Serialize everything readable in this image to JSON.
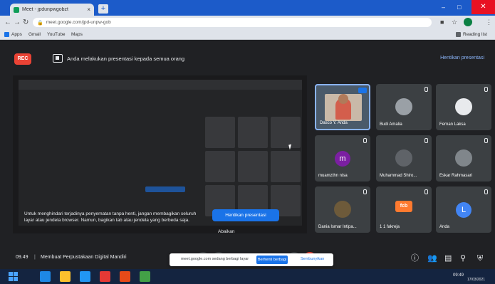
{
  "browser": {
    "tab_title": "Meet - jpdunpwgobzt",
    "tab_close": "×",
    "new_tab": "+",
    "window_controls": [
      "–",
      "□",
      "✕"
    ],
    "address": "meet.google.com/jpd-unpw-gob",
    "bookmarks": [
      "Apps",
      "Gmail",
      "YouTube",
      "Maps"
    ],
    "reading_list": "Reading list"
  },
  "meet": {
    "rec_label": "REC",
    "presenting_text": "Anda melakukan presentasi kepada semua orang",
    "stop_presenting": "Hentikan presentasi",
    "warning_text": "Untuk menghindari terjadinya penyematan tanpa henti, jangan membagikan seluruh layar atau jendela browser. Namun, bagikan tab atau jendela yang berbeda saja.",
    "warning_button": "Hentikan presentasi",
    "warning_dismiss": "Abaikan",
    "participants": [
      {
        "name": "Dasco Y. Anda",
        "kind": "self"
      },
      {
        "name": "Budi Amalia",
        "kind": "photo"
      },
      {
        "name": "Fernan Laksa",
        "kind": "photo"
      },
      {
        "name": "m",
        "label": "muamzthn nisa",
        "kind": "letter",
        "color": "#7b1fa2"
      },
      {
        "name": "Muhammad Shiro...",
        "kind": "photo"
      },
      {
        "name": "Eskar Rahmasari",
        "kind": "photo"
      },
      {
        "name": "Dania Ismar Intipa...",
        "kind": "photo"
      },
      {
        "name": "1 1 fakreja",
        "kind": "app",
        "app_label": "fcb"
      },
      {
        "name": "Anda",
        "kind": "letter-blue",
        "letter": "L"
      }
    ],
    "time": "09.49",
    "separator": "|",
    "meeting_title": "Membuat Perpustakaan Digital Mandiri",
    "notification": {
      "text": "meet.google.com sedang berbagi layar",
      "button": "Berhenti berbagi",
      "hide": "Sembunyikan"
    }
  },
  "taskbar": {
    "time": "09:49",
    "date": "17/03/2021"
  }
}
